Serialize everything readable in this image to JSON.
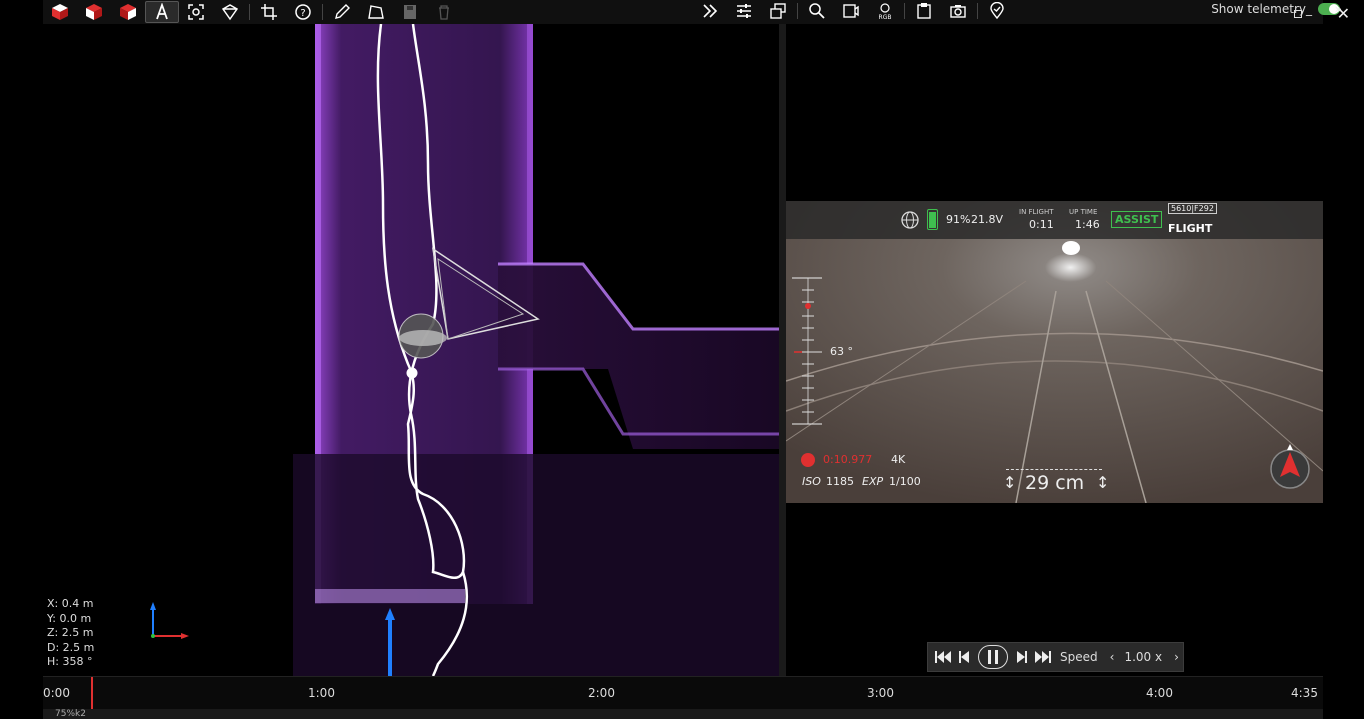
{
  "toolbar": {
    "left_icons": [
      "cube-red-icon",
      "cube-red-alt-icon",
      "cube-red-side-icon",
      "cursor-A-icon",
      "screenshot-frame-icon",
      "gem-icon",
      "crop-icon",
      "help-circle-icon",
      "pencil-icon",
      "polygon-icon",
      "save-icon",
      "trash-icon"
    ],
    "right_icons": [
      "double-chevron-icon",
      "sliders-icon",
      "layers-icon",
      "zoom-icon",
      "video-export-icon",
      "rgb-icon",
      "clipboard-icon",
      "camera-icon",
      "location-pin-icon"
    ],
    "telemetry_label": "Show telemetry_",
    "telemetry_on": true
  },
  "viewport": {
    "coords": {
      "x": "X:  0.4 m",
      "y": "Y:  0.0 m",
      "z": "Z:  2.5 m",
      "d": "D:  2.5 m",
      "h": "H:  358 °"
    }
  },
  "camera": {
    "battery_pct": "91%",
    "voltage": "21.8V",
    "in_flight_label": "IN FLIGHT",
    "in_flight_time": "0:11",
    "up_time_label": "UP TIME",
    "up_time": "1:46",
    "mode": "ASSIST",
    "firmware": "5610|F292",
    "state": "FLIGHT",
    "tilt": "63 °",
    "rec_time": "0:10.977",
    "resolution": "4K",
    "iso_label": "ISO",
    "iso": "1185",
    "exp_label": "EXP",
    "exp": "1/100",
    "distance": "29 cm"
  },
  "playback": {
    "speed_label": "Speed",
    "speed_value": "1.00 x"
  },
  "timeline": {
    "ticks": [
      "0:00",
      "1:00",
      "2:00",
      "3:00",
      "4:00",
      "4:35"
    ],
    "scroll_label": "75%k2"
  },
  "colors": {
    "accent": "#e03030",
    "assist": "#3fbf4f",
    "lidar": "#8a3cc8"
  }
}
